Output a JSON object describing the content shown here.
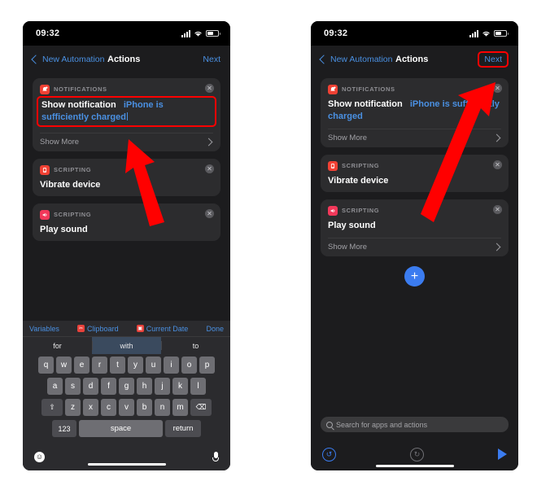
{
  "status_bar": {
    "time": "09:32",
    "signal_icon": "cellular-bars-icon",
    "wifi_icon": "wifi-icon",
    "battery_icon": "battery-icon"
  },
  "left_phone": {
    "nav": {
      "back_label": "New Automation",
      "title": "Actions",
      "next_label": "Next"
    },
    "cards": [
      {
        "category": "NOTIFICATIONS",
        "icon": "notifications-app-icon",
        "title": "Show notification",
        "token": "iPhone is sufficiently charged",
        "show_more": "Show More",
        "highlighted": true
      },
      {
        "category": "SCRIPTING",
        "icon": "scripting-app-icon",
        "title": "Vibrate device",
        "token": "",
        "show_more": "",
        "highlighted": false
      },
      {
        "category": "SCRIPTING",
        "icon": "play-sound-icon",
        "title": "Play sound",
        "token": "",
        "show_more": "",
        "highlighted": false
      }
    ],
    "keyboard": {
      "accessory": [
        {
          "label": "Variables",
          "icon": ""
        },
        {
          "label": "Clipboard",
          "icon": "clipboard-icon"
        },
        {
          "label": "Current Date",
          "icon": "calendar-icon"
        },
        {
          "label": "Done",
          "icon": ""
        }
      ],
      "predictions": [
        "for",
        "with",
        "to"
      ],
      "selected_prediction": "with",
      "row1": [
        "q",
        "w",
        "e",
        "r",
        "t",
        "y",
        "u",
        "i",
        "o",
        "p"
      ],
      "row2": [
        "a",
        "s",
        "d",
        "f",
        "g",
        "h",
        "j",
        "k",
        "l"
      ],
      "row3": [
        "z",
        "x",
        "c",
        "v",
        "b",
        "n",
        "m"
      ],
      "shift_icon": "shift-icon",
      "backspace_icon": "backspace-icon",
      "numbers_label": "123",
      "space_label": "space",
      "return_label": "return",
      "emoji_icon": "emoji-icon",
      "mic_icon": "microphone-icon"
    }
  },
  "right_phone": {
    "nav": {
      "back_label": "New Automation",
      "title": "Actions",
      "next_label": "Next"
    },
    "cards": [
      {
        "category": "NOTIFICATIONS",
        "icon": "notifications-app-icon",
        "title": "Show notification",
        "token": "iPhone is sufficiently charged",
        "show_more": "Show More"
      },
      {
        "category": "SCRIPTING",
        "icon": "scripting-app-icon",
        "title": "Vibrate device",
        "token": "",
        "show_more": ""
      },
      {
        "category": "SCRIPTING",
        "icon": "play-sound-icon",
        "title": "Play sound",
        "token": "",
        "show_more": "Show More"
      }
    ],
    "add_button": {
      "icon": "plus-icon",
      "label": "+"
    },
    "search": {
      "placeholder": "Search for apps and actions",
      "icon": "search-icon"
    },
    "toolbar": {
      "undo_icon": "undo-icon",
      "redo_icon": "redo-icon",
      "run_icon": "play-icon"
    }
  },
  "annotations": {
    "arrow_left": "red-arrow-up-left",
    "arrow_right": "red-arrow-up-right",
    "highlight_color": "#ff0000"
  }
}
